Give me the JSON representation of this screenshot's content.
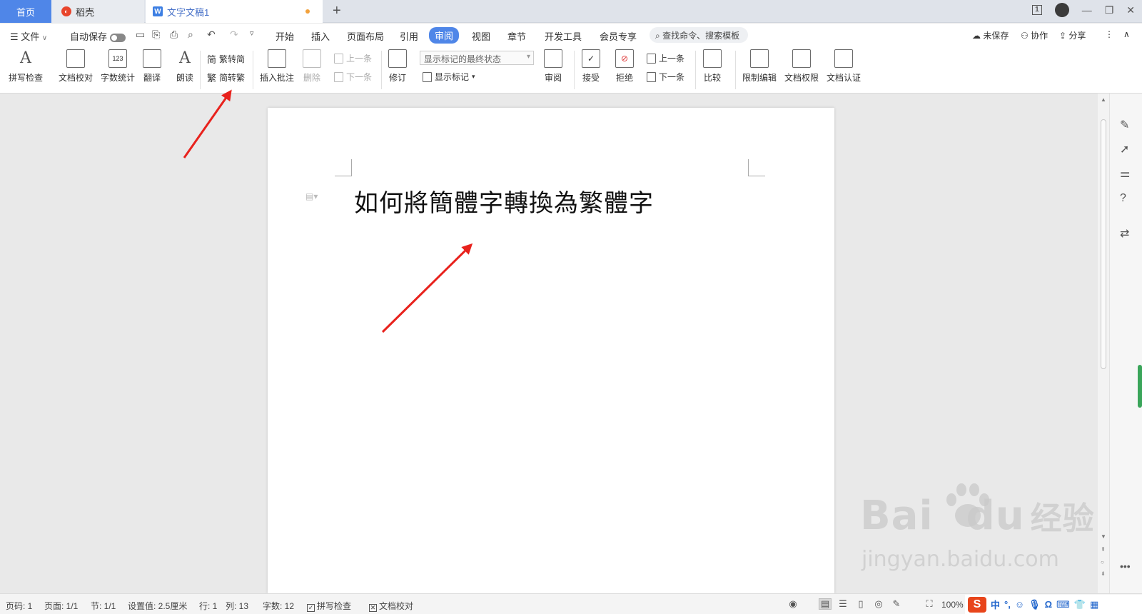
{
  "tabs": {
    "home": "首页",
    "daoke": "稻壳",
    "doc": "文字文稿1"
  },
  "window": {
    "screen_badge": "1"
  },
  "menubar": {
    "file": "文件",
    "autosave": "自动保存",
    "tabs": [
      "开始",
      "插入",
      "页面布局",
      "引用",
      "审阅",
      "视图",
      "章节",
      "开发工具",
      "会员专享"
    ],
    "active_tab": "审阅",
    "search_placeholder": "查找命令、搜索模板",
    "unsaved": "未保存",
    "collab": "协作",
    "share": "分享"
  },
  "ribbon": {
    "spell_check": "拼写检查",
    "doc_proof": "文档校对",
    "word_count": "字数统计",
    "translate": "翻译",
    "read_aloud": "朗读",
    "trad_to_simp": "繁转简",
    "simp_to_trad": "简转繁",
    "insert_comment": "插入批注",
    "delete": "删除",
    "prev_item": "上一条",
    "next_item": "下一条",
    "track_changes": "修订",
    "markup_state": "显示标记的最终状态",
    "show_markup": "显示标记",
    "review": "审阅",
    "accept": "接受",
    "reject": "拒绝",
    "prev_change": "上一条",
    "next_change": "下一条",
    "compare": "比较",
    "restrict_edit": "限制编辑",
    "doc_permission": "文档权限",
    "doc_cert": "文档认证"
  },
  "document": {
    "title": "如何將簡體字轉換為繁體字"
  },
  "watermark": {
    "main": "Bai",
    "du": "du",
    "cn": "经验",
    "url": "jingyan.baidu.com"
  },
  "statusbar": {
    "page_num": "页码: 1",
    "pages": "页面: 1/1",
    "section": "节: 1/1",
    "setting": "设置值: 2.5厘米",
    "row": "行: 1",
    "col": "列: 13",
    "word_count": "字数: 12",
    "spell_check": "拼写检查",
    "doc_proof": "文档校对",
    "zoom": "100%"
  },
  "ime": {
    "lang": "中"
  },
  "colors": {
    "accent": "#4f86e8",
    "arrow": "#e8221d",
    "ime": "#e8451b"
  }
}
